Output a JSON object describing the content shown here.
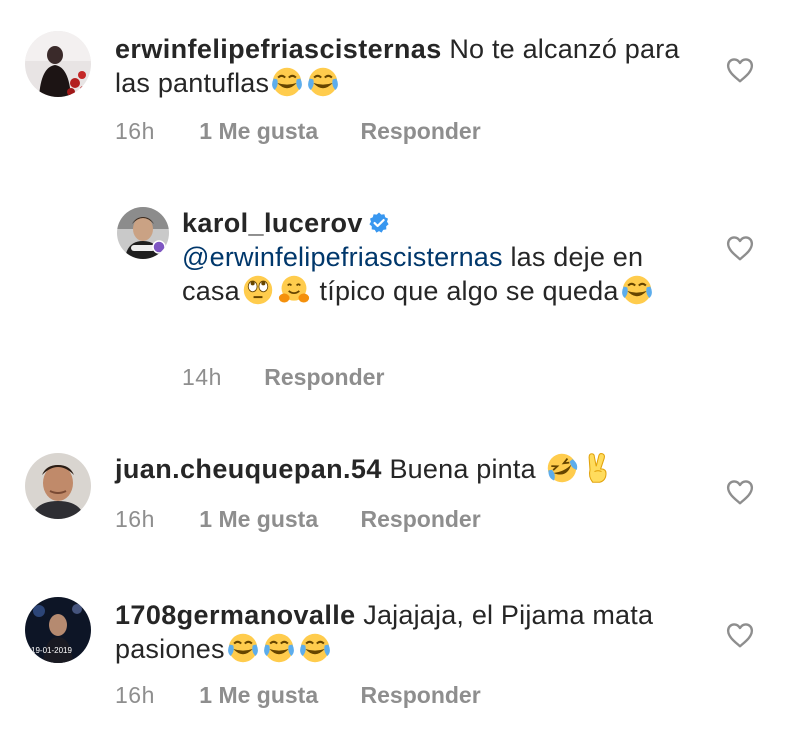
{
  "comments": [
    {
      "username": "erwinfelipefriascisternas",
      "text": "No te alcanzó para las pantuflas",
      "emojis": [
        "face-with-tears-of-joy",
        "face-with-tears-of-joy"
      ],
      "time": "16h",
      "likes": "1 Me gusta",
      "reply": "Responder"
    },
    {
      "username": "karol_lucerov",
      "verified": true,
      "mention": "@erwinfelipefriascisternas",
      "text_a": "las deje en casa",
      "text_b": "típico que algo se queda",
      "emojis": [
        "face-with-rolling-eyes",
        "hugging-face",
        "face-with-tears-of-joy"
      ],
      "time": "14h",
      "reply": "Responder"
    },
    {
      "username": "juan.cheuquepan.54",
      "text": "Buena pinta",
      "emojis": [
        "rolling-on-floor-laughing",
        "victory-hand"
      ],
      "time": "16h",
      "likes": "1 Me gusta",
      "reply": "Responder"
    },
    {
      "username": "1708germanovalle",
      "text": "Jajajaja, el Pijama mata pasiones",
      "emojis": [
        "face-with-tears-of-joy",
        "face-with-tears-of-joy",
        "face-with-tears-of-joy"
      ],
      "time": "16h",
      "likes": "1 Me gusta",
      "reply": "Responder",
      "avatar_text": "19-01-2019"
    }
  ],
  "colors": {
    "text": "#262626",
    "muted": "#8e8e8e",
    "mention": "#00376b",
    "verified": "#3897f0"
  },
  "icons": [
    "heart-outline-icon",
    "verified-badge-icon"
  ]
}
